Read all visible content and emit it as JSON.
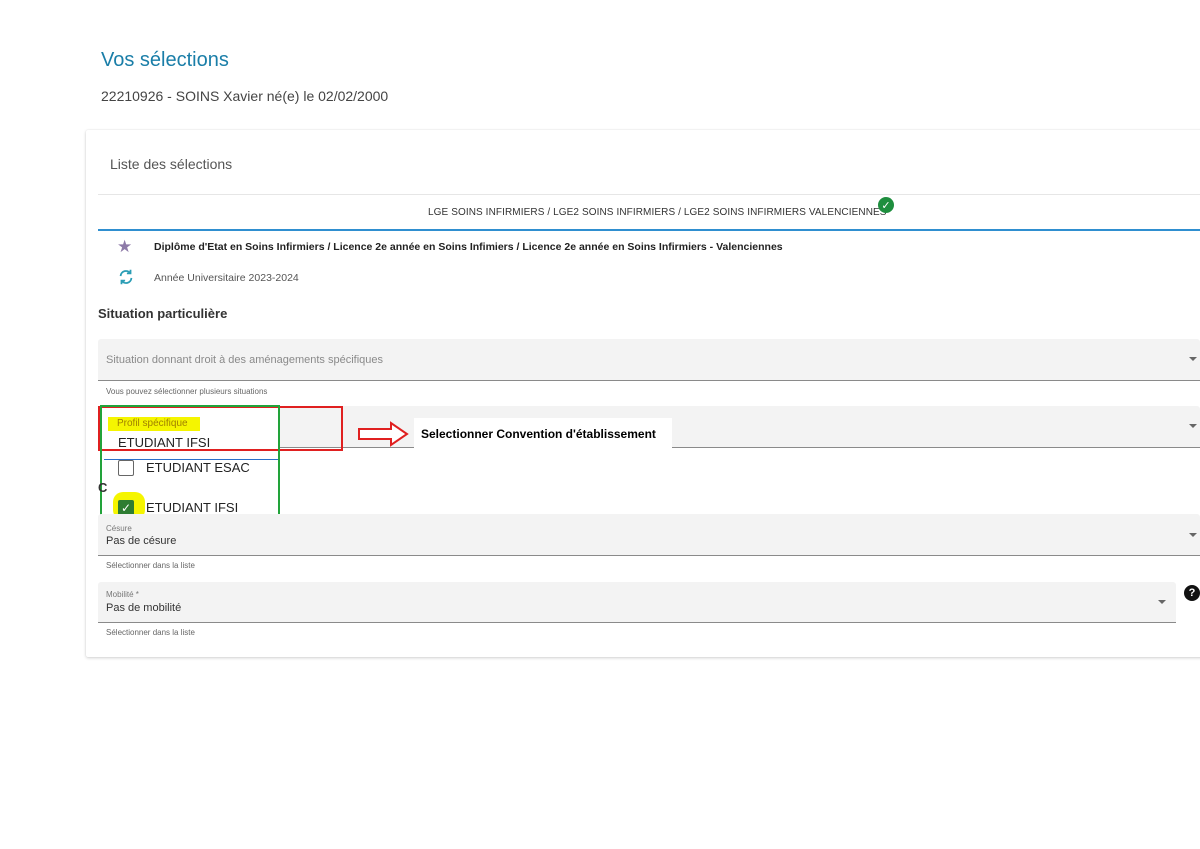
{
  "header": {
    "title": "Vos sélections",
    "student_line": "22210926 - SOINS Xavier né(e) le 02/02/2000"
  },
  "card": {
    "title": "Liste des sélections",
    "selection_tab": "LGE SOINS INFIRMIERS / LGE2 SOINS INFIRMIERS / LGE2 SOINS INFIRMIERS VALENCIENNES",
    "diploma": "Diplôme d'Etat en Soins Infirmiers / Licence 2e année en Soins Infimiers / Licence 2e année en Soins Infirmiers - Valenciennes",
    "academic_year": "Année Universitaire 2023-2024"
  },
  "situation": {
    "heading": "Situation particulière",
    "situation_placeholder": "Situation donnant droit à des aménagements spécifiques",
    "situation_hint": "Vous pouvez sélectionner plusieurs situations",
    "profil_label": "Profil spécifique",
    "profil_value": "ETUDIANT IFSI",
    "profil_options": [
      {
        "label": "ETUDIANT ESAC",
        "checked": false
      },
      {
        "label": "ETUDIANT IFSI",
        "checked": true
      }
    ],
    "annotation": "Selectionner Convention d'établissement",
    "stray_char": "C",
    "cesure_label": "Césure",
    "cesure_value": "Pas de césure",
    "cesure_hint": "Sélectionner dans la liste",
    "mobilite_label": "Mobilité *",
    "mobilite_value": "Pas de mobilité",
    "mobilite_hint": "Sélectionner dans la liste"
  },
  "icons": {
    "check": "✓",
    "star": "★",
    "help": "?"
  },
  "colors": {
    "accent": "#1a7ea8",
    "tab_underline": "#2f8fd0",
    "annotation_red": "#e02020",
    "annotation_green": "#22a33a",
    "highlight_yellow": "#f5f500",
    "checked_green": "#2e7d32"
  }
}
